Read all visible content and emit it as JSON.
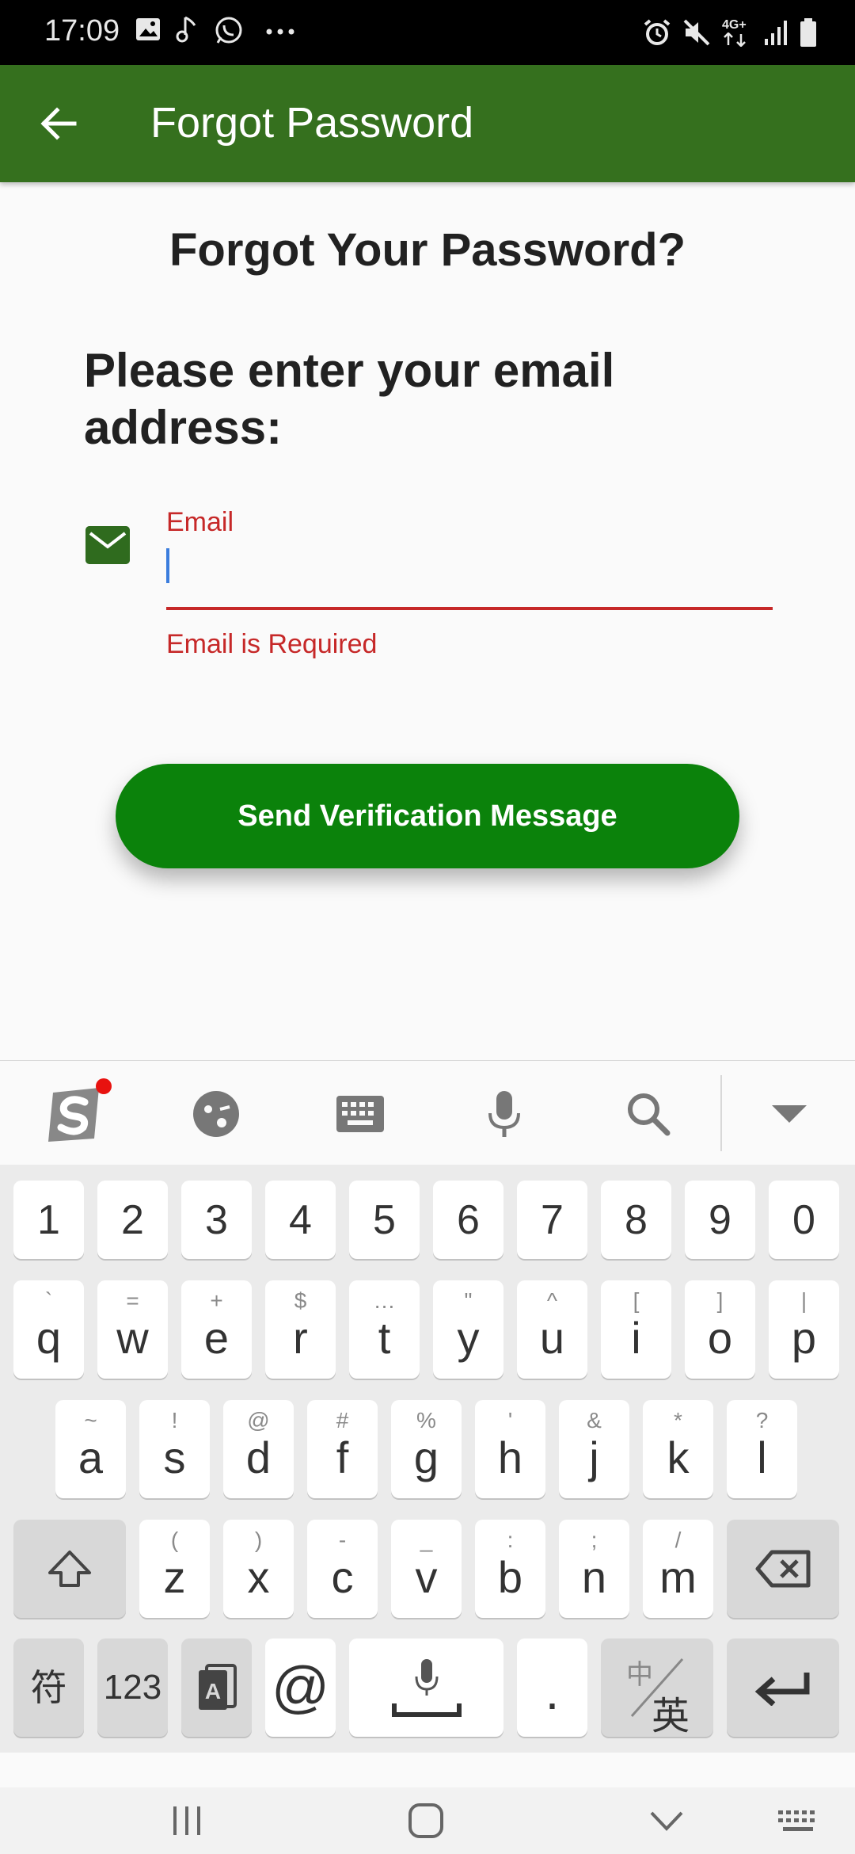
{
  "status_bar": {
    "time": "17:09",
    "network": "4G+"
  },
  "app_bar": {
    "title": "Forgot Password"
  },
  "content": {
    "heading": "Forgot Your Password?",
    "subheading": "Please enter your email address:",
    "email_label": "Email",
    "email_value": "",
    "email_error": "Email is Required",
    "send_button": "Send Verification Message"
  },
  "colors": {
    "app_bar": "#35701e",
    "button": "#0b820b",
    "error": "#c62828",
    "cursor": "#3b7ddd"
  },
  "keyboard": {
    "digits": [
      "1",
      "2",
      "3",
      "4",
      "5",
      "6",
      "7",
      "8",
      "9",
      "0"
    ],
    "row1": [
      {
        "main": "q",
        "sub": "`"
      },
      {
        "main": "w",
        "sub": "="
      },
      {
        "main": "e",
        "sub": "+"
      },
      {
        "main": "r",
        "sub": "$"
      },
      {
        "main": "t",
        "sub": "…"
      },
      {
        "main": "y",
        "sub": "\""
      },
      {
        "main": "u",
        "sub": "^"
      },
      {
        "main": "i",
        "sub": "["
      },
      {
        "main": "o",
        "sub": "]"
      },
      {
        "main": "p",
        "sub": "|"
      }
    ],
    "row2": [
      {
        "main": "a",
        "sub": "~"
      },
      {
        "main": "s",
        "sub": "!"
      },
      {
        "main": "d",
        "sub": "@"
      },
      {
        "main": "f",
        "sub": "#"
      },
      {
        "main": "g",
        "sub": "%"
      },
      {
        "main": "h",
        "sub": "'"
      },
      {
        "main": "j",
        "sub": "&"
      },
      {
        "main": "k",
        "sub": "*"
      },
      {
        "main": "l",
        "sub": "?"
      }
    ],
    "row3": [
      {
        "main": "z",
        "sub": "("
      },
      {
        "main": "x",
        "sub": ")"
      },
      {
        "main": "c",
        "sub": "-"
      },
      {
        "main": "v",
        "sub": "_"
      },
      {
        "main": "b",
        "sub": ":"
      },
      {
        "main": "n",
        "sub": ";"
      },
      {
        "main": "m",
        "sub": "/"
      }
    ],
    "symbols_key": "符",
    "numbers_key": "123",
    "at_key": "@",
    "period_key": ".",
    "lang_key_top": "中",
    "lang_key_bottom": "英"
  },
  "icons": {
    "toolbar": [
      "sogou-logo-icon",
      "emoji-icon",
      "keyboard-icon",
      "microphone-icon",
      "search-icon",
      "collapse-icon"
    ],
    "nav": [
      "recent-apps-icon",
      "home-icon",
      "back-icon",
      "keyboard-switch-icon"
    ]
  }
}
